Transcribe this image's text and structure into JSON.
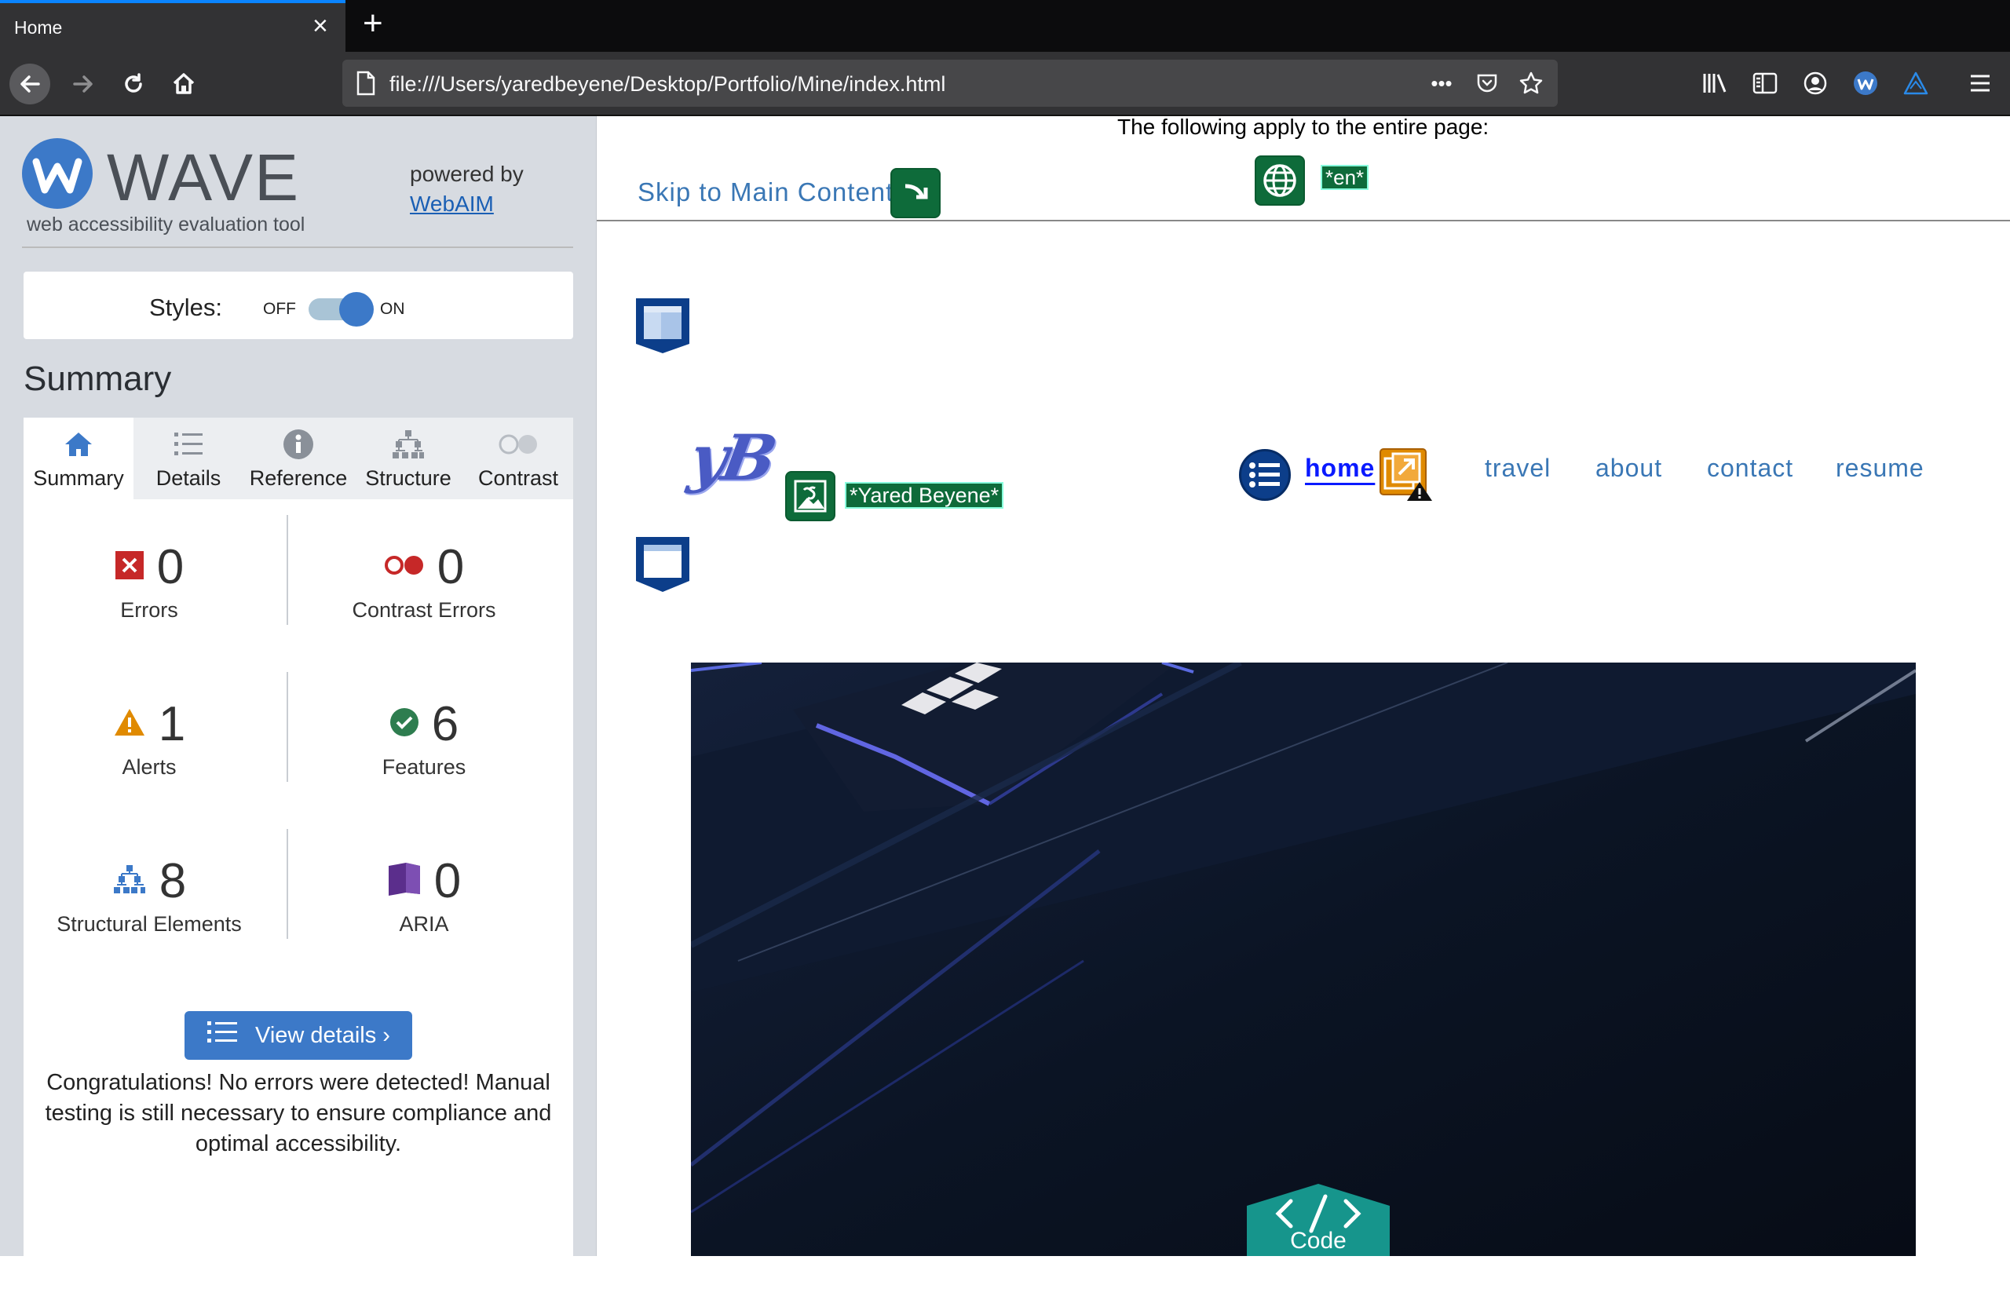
{
  "browser": {
    "tab_title": "Home",
    "url": "file:///Users/yaredbeyene/Desktop/Portfolio/Mine/index.html"
  },
  "wave": {
    "logo_text": "WAVE",
    "tagline": "web accessibility evaluation tool",
    "powered_by": "powered by",
    "webaim_link": "WebAIM",
    "styles_label": "Styles:",
    "styles_off": "OFF",
    "styles_on": "ON",
    "styles_state": "on",
    "summary_heading": "Summary",
    "tabs": [
      {
        "label": "Summary",
        "icon": "home-icon",
        "active": true
      },
      {
        "label": "Details",
        "icon": "list-icon",
        "active": false
      },
      {
        "label": "Reference",
        "icon": "info-icon",
        "active": false
      },
      {
        "label": "Structure",
        "icon": "structure-icon",
        "active": false
      },
      {
        "label": "Contrast",
        "icon": "contrast-icon",
        "active": false
      }
    ],
    "stats": {
      "errors": {
        "value": "0",
        "label": "Errors",
        "icon": "error-icon"
      },
      "contrast_errors": {
        "value": "0",
        "label": "Contrast Errors",
        "icon": "contrast-error-icon"
      },
      "alerts": {
        "value": "1",
        "label": "Alerts",
        "icon": "alert-icon"
      },
      "features": {
        "value": "6",
        "label": "Features",
        "icon": "feature-check-icon"
      },
      "structural": {
        "value": "8",
        "label": "Structural Elements",
        "icon": "structure-icon"
      },
      "aria": {
        "value": "0",
        "label": "ARIA",
        "icon": "aria-icon"
      }
    },
    "view_details": "View details ›",
    "congrats": "Congratulations! No errors were detected! Manual testing is still necessary to ensure compliance and optimal accessibility.",
    "colors": {
      "accent": "#3c79c8",
      "error": "#c62828",
      "alert": "#e08a00",
      "feature": "#2e7d4f",
      "aria": "#5b2e8c"
    }
  },
  "page": {
    "apply_text": "The following apply to the entire page:",
    "skip_link": "Skip to Main Content",
    "lang_badge": "*en*",
    "logo_text": "yB",
    "logo_alt_badge": "*Yared Beyene*",
    "nav": {
      "home": "home",
      "travel": "travel",
      "about": "about",
      "contact": "contact",
      "resume": "resume"
    },
    "code_badge": "Code"
  }
}
